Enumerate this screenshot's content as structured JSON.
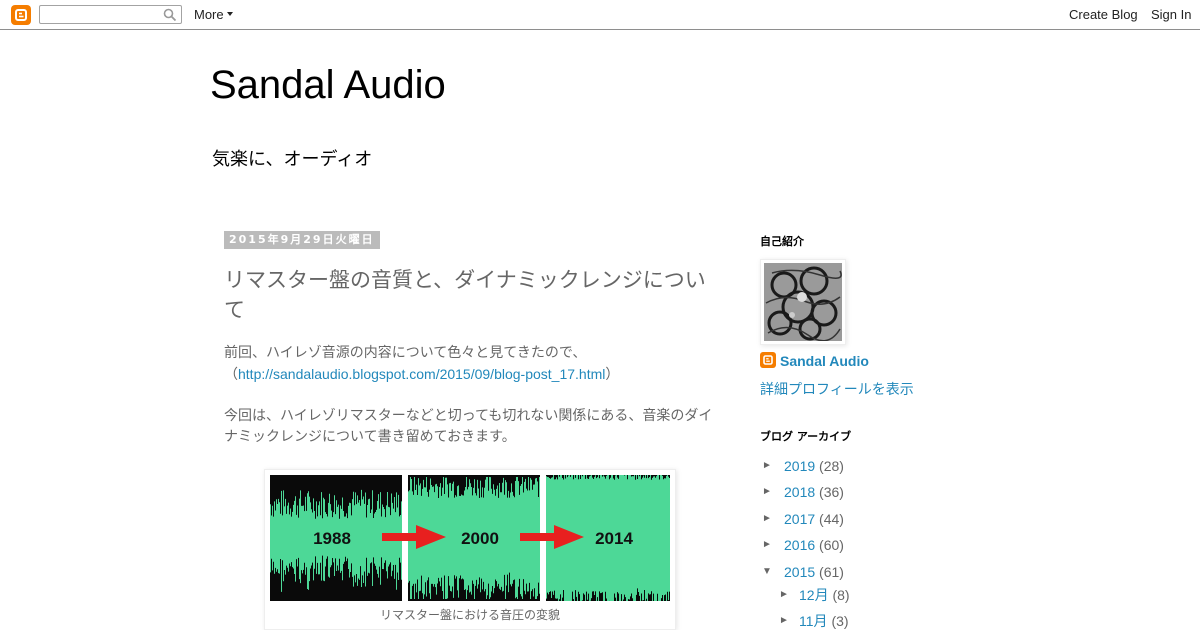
{
  "navbar": {
    "logo_icon": "blogger-logo-icon",
    "search_value": "",
    "search_icon": "search-icon",
    "more_label": "More",
    "create_blog_label": "Create Blog",
    "sign_in_label": "Sign In"
  },
  "header": {
    "title": "Sandal Audio",
    "description": "気楽に、オーディオ"
  },
  "post": {
    "date": "2015年9月29日火曜日",
    "title": "リマスター盤の音質と、ダイナミックレンジについて",
    "paragraph1": "前回、ハイレゾ音源の内容について色々と見てきたので、",
    "paren_open": "（",
    "link": "http://sandalaudio.blogspot.com/2015/09/blog-post_17.html",
    "paren_close": "）",
    "paragraph2": "今回は、ハイレゾリマスターなどと切っても切れない関係にある、音楽のダイナミックレンジについて書き留めておきます。",
    "figure": {
      "labels": [
        "1988",
        "2000",
        "2014"
      ],
      "caption": "リマスター盤における音圧の変貌",
      "waveform_color": "#4dd897",
      "arrow_color": "#e8201f"
    }
  },
  "sidebar": {
    "profile_title": "自己紹介",
    "profile_name": "Sandal Audio",
    "profile_link": "詳細プロフィールを表示",
    "archive_title": "ブログ アーカイブ",
    "archive": [
      {
        "toggle": "►",
        "label": "2019",
        "count": "(28)"
      },
      {
        "toggle": "►",
        "label": "2018",
        "count": "(36)"
      },
      {
        "toggle": "►",
        "label": "2017",
        "count": "(44)"
      },
      {
        "toggle": "►",
        "label": "2016",
        "count": "(60)"
      },
      {
        "toggle": "▼",
        "label": "2015",
        "count": "(61)"
      },
      {
        "toggle": "►",
        "label": "12月",
        "count": "(8)"
      },
      {
        "toggle": "►",
        "label": "11月",
        "count": "(3)"
      }
    ]
  },
  "colors": {
    "link": "#2288bb",
    "brand": "#f57d00",
    "text_muted": "#666666"
  }
}
